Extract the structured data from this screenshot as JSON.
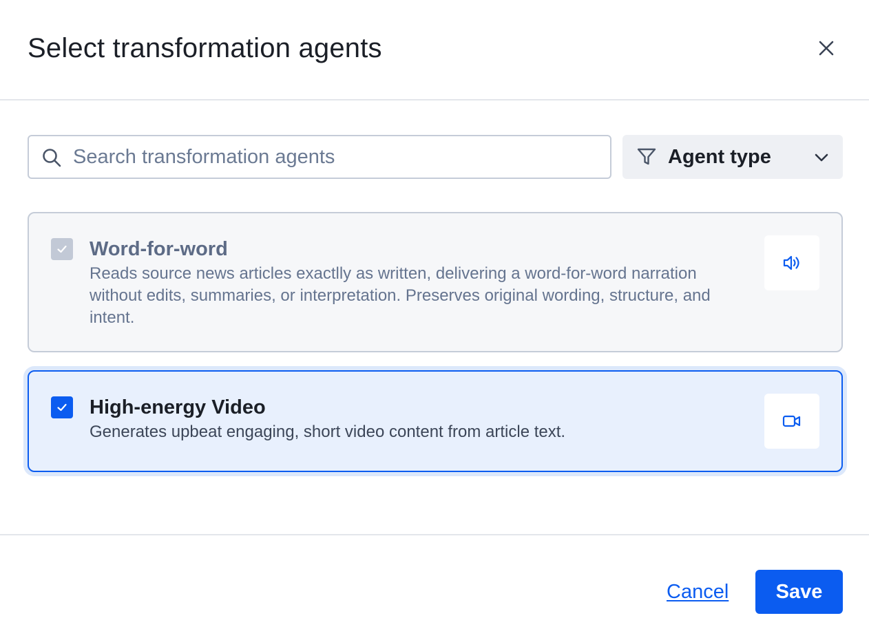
{
  "dialog": {
    "title": "Select transformation agents"
  },
  "search": {
    "placeholder": "Search transformation agents",
    "value": ""
  },
  "filter": {
    "label": "Agent type"
  },
  "agents": [
    {
      "title": "Word-for-word",
      "description": "Reads source news articles exactlly as written, delivering a word-for-word narration without edits, summaries, or interpretation. Preserves original wording, structure, and intent.",
      "checked": true,
      "disabled": true,
      "type_icon": "speaker-icon"
    },
    {
      "title": "High-energy Video",
      "description": "Generates upbeat engaging, short video content from article text.",
      "checked": true,
      "disabled": false,
      "type_icon": "video-camera-icon"
    }
  ],
  "footer": {
    "cancel_label": "Cancel",
    "save_label": "Save"
  },
  "colors": {
    "accent": "#0b5cf0",
    "disabled_check": "#c2c9d6",
    "selected_card_bg": "#e8f0fd"
  }
}
